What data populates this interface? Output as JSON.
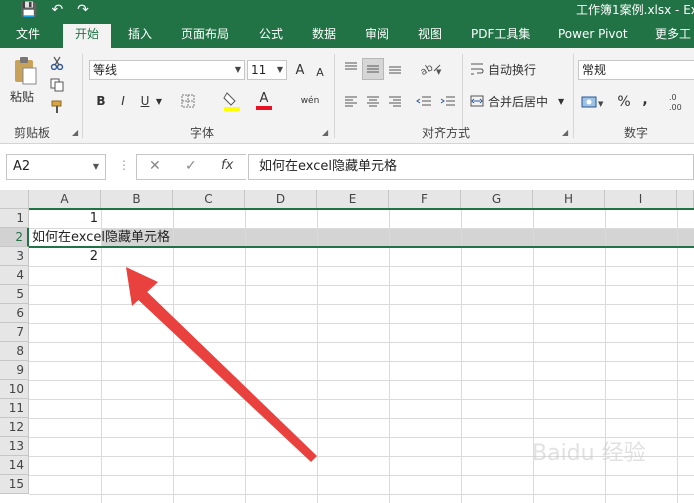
{
  "window": {
    "title": "工作簿1案例.xlsx - Exc"
  },
  "qat": {
    "save_glyph": "💾",
    "undo_glyph": "↶",
    "redo_glyph": "↷"
  },
  "tabs": [
    {
      "label": "文件"
    },
    {
      "label": "开始"
    },
    {
      "label": "插入"
    },
    {
      "label": "页面布局"
    },
    {
      "label": "公式"
    },
    {
      "label": "数据"
    },
    {
      "label": "审阅"
    },
    {
      "label": "视图"
    },
    {
      "label": "PDF工具集"
    },
    {
      "label": "Power Pivot"
    },
    {
      "label": "更多工"
    }
  ],
  "ribbon": {
    "clipboard": {
      "label": "剪贴板",
      "paste": "粘贴"
    },
    "font": {
      "label": "字体",
      "name": "等线",
      "size": "11",
      "bold": "B",
      "italic": "I",
      "underline": "U",
      "grow": "A",
      "shrink": "A",
      "font_color": "A",
      "phonetic": "wén"
    },
    "alignment": {
      "label": "对齐方式",
      "wrap": "自动换行",
      "merge": "合并后居中"
    },
    "number": {
      "label": "数字",
      "format": "常规",
      "percent": "%",
      "comma": ","
    }
  },
  "formula_bar": {
    "name_box": "A2",
    "cancel": "✕",
    "enter": "✓",
    "fx": "fx",
    "content": "如何在excel隐藏单元格"
  },
  "columns": [
    "A",
    "B",
    "C",
    "D",
    "E",
    "F",
    "G",
    "H",
    "I"
  ],
  "rows": [
    "1",
    "2",
    "3",
    "4",
    "5",
    "6",
    "7",
    "8",
    "9",
    "10",
    "11",
    "12",
    "13",
    "14",
    "15"
  ],
  "cells": {
    "A1": "1",
    "A2": "如何在excel隐藏单元格",
    "A3": "2"
  },
  "colors": {
    "brand": "#217346",
    "selection": "#d4d4d4",
    "arrow": "#e8413e"
  },
  "watermark": "Baidu 经验"
}
